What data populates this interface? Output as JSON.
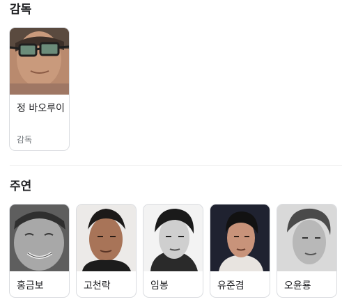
{
  "director_section": {
    "title": "감독",
    "people": [
      {
        "name": "정 바오루이",
        "role": "감독"
      }
    ]
  },
  "cast_section": {
    "title": "주연",
    "people": [
      {
        "name": "홍금보"
      },
      {
        "name": "고천락"
      },
      {
        "name": "임봉"
      },
      {
        "name": "유준겸"
      },
      {
        "name": "오윤룡"
      }
    ]
  }
}
